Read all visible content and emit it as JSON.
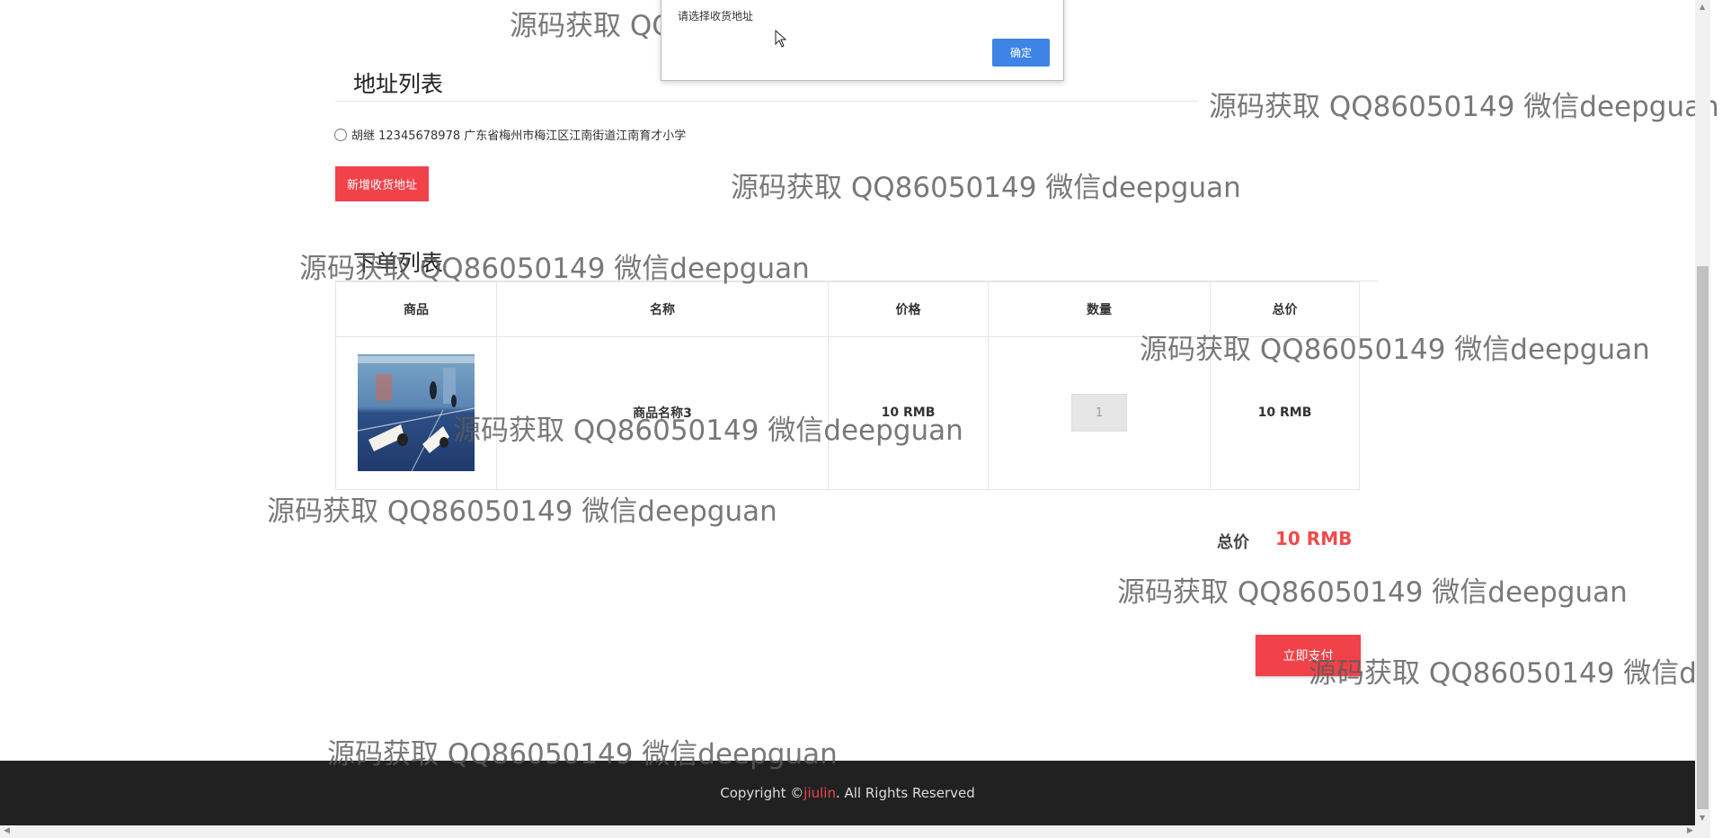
{
  "address_section": {
    "title": "地址列表",
    "address_text": "胡继 12345678978 广东省梅州市梅江区江南街道江南育才小学",
    "add_button": "新增收货地址"
  },
  "order_section": {
    "title": "下单列表",
    "headers": [
      "商品",
      "名称",
      "价格",
      "数量",
      "总价"
    ],
    "item": {
      "image_icon": "badminton-shuttlecock-image",
      "name": "商品名称3",
      "price": "10 RMB",
      "quantity": "1",
      "total": "10 RMB"
    }
  },
  "summary": {
    "total_label": "总价",
    "total_value": "10 RMB",
    "pay_button": "立即支付"
  },
  "footer": {
    "prefix": "Copyright © ",
    "brand": "jiulin",
    "suffix": ". All Rights Reserved"
  },
  "alert": {
    "message": "请选择收货地址",
    "ok_button": "确定"
  },
  "watermark": {
    "text": "源码获取 QQ86050149 微信deepguan"
  },
  "colors": {
    "accent_red": "#f1424a",
    "footer_bg": "#212121",
    "dialog_button": "#3d84e6"
  }
}
